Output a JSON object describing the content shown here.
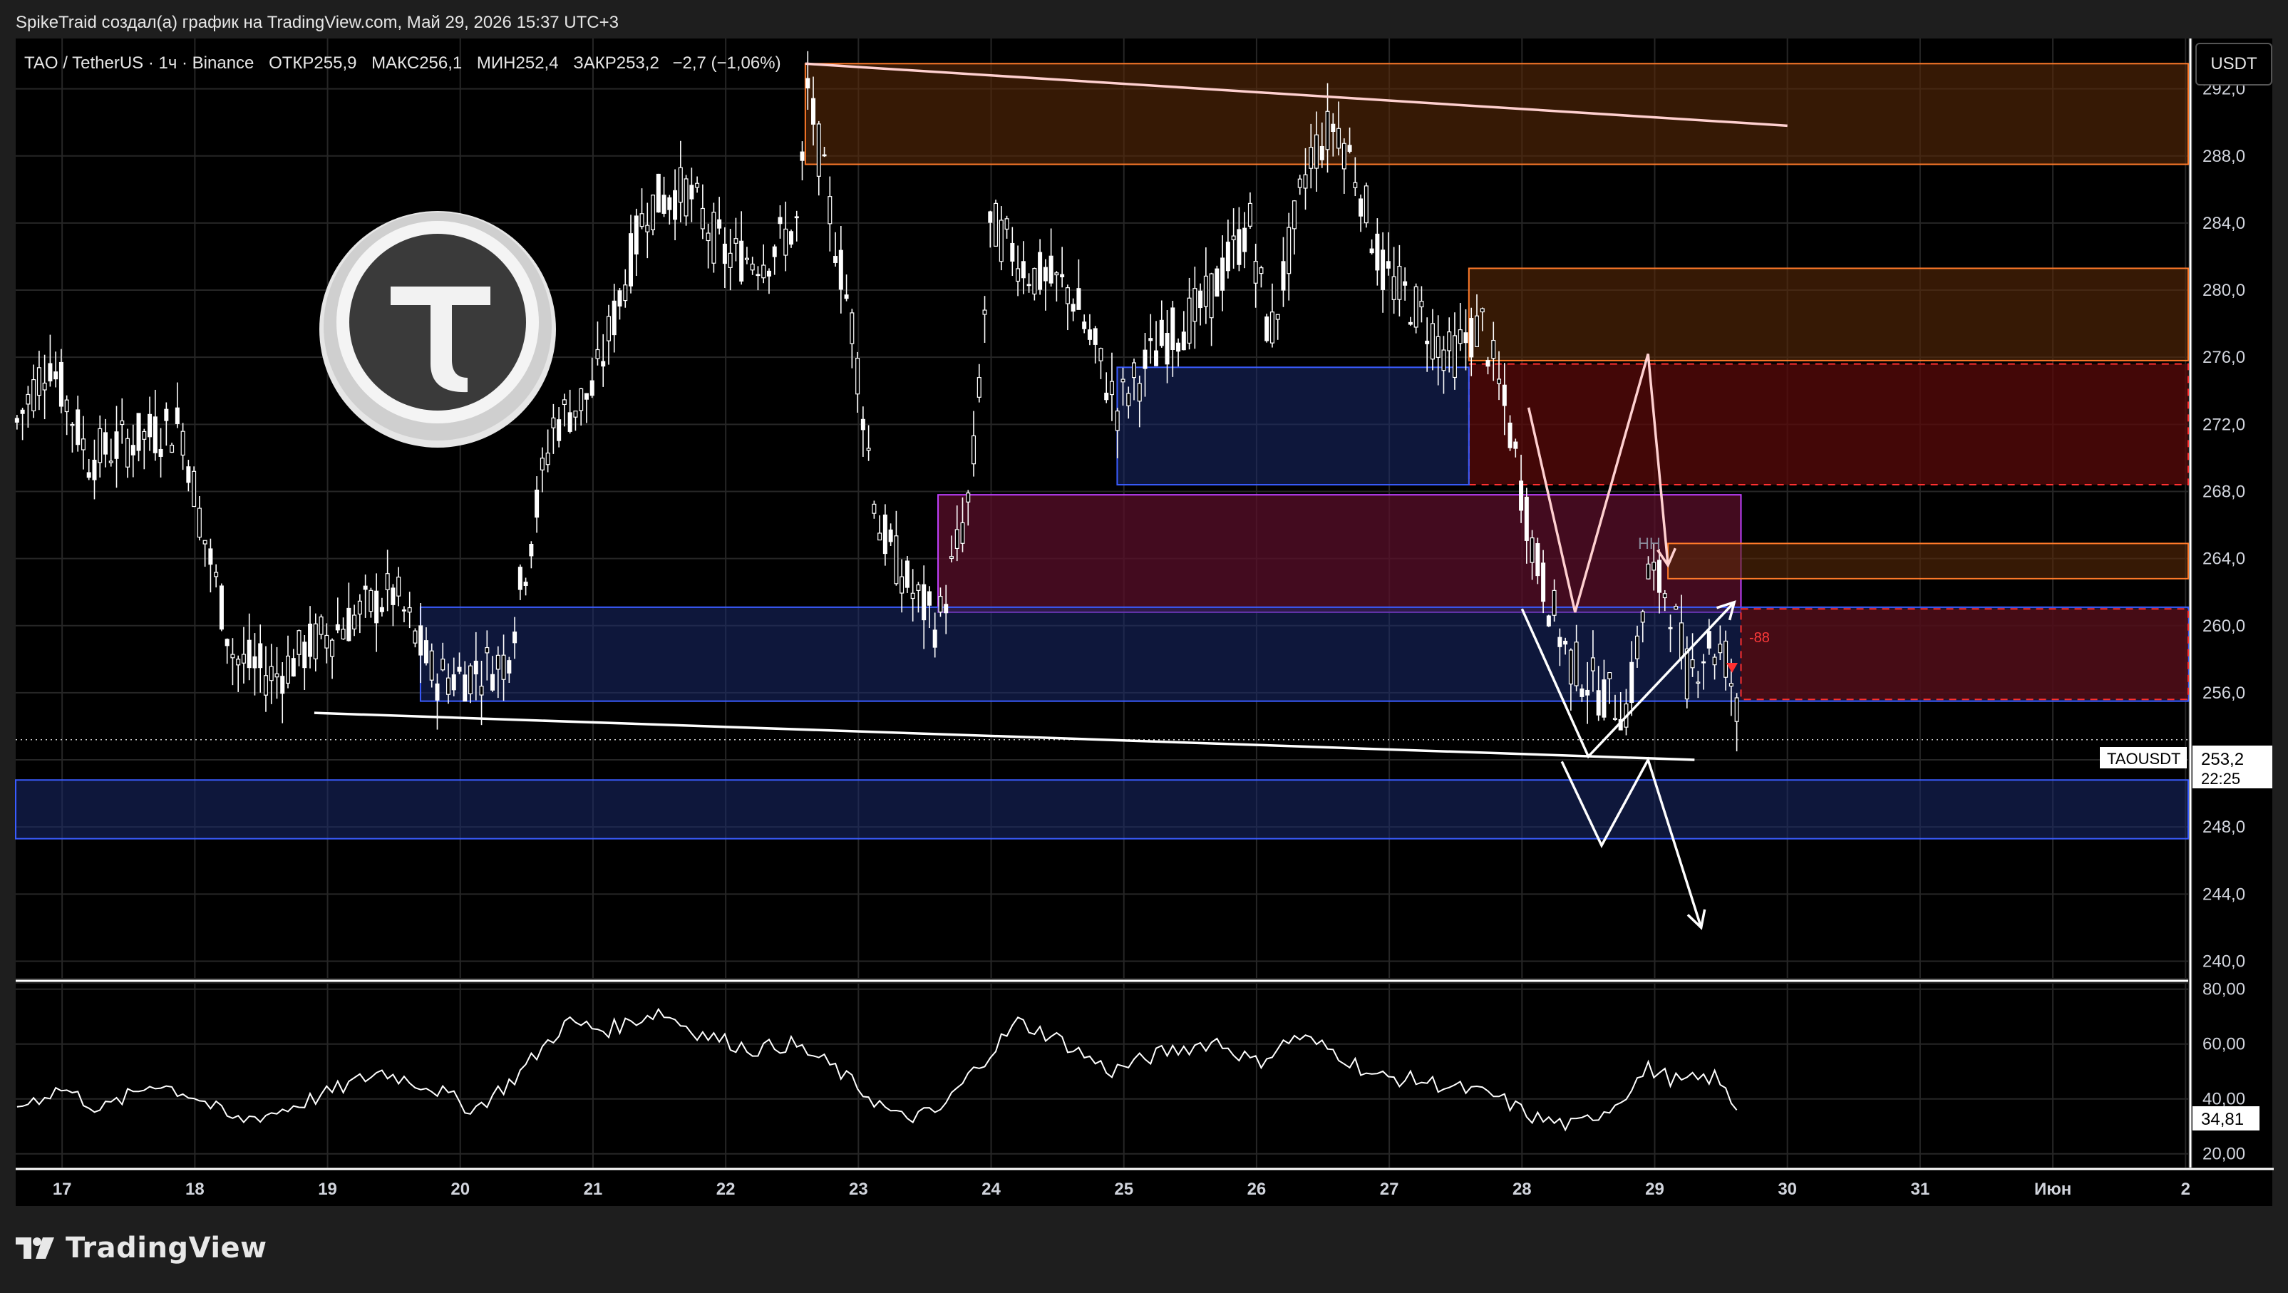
{
  "header": {
    "attribution": "SpikeTraid создал(а) график на TradingView.com, Май 29, 2026 15:37 UTC+3"
  },
  "legend": {
    "symbol": "TAO / TetherUS · 1ч · Binance",
    "open_label": "ОТКР",
    "open_value": "255,9",
    "high_label": "МАКС",
    "high_value": "256,1",
    "low_label": "МИН",
    "low_value": "252,4",
    "close_label": "ЗАКР",
    "close_value": "253,2",
    "change": "−2,7 (−1,06%)"
  },
  "currency_button": "USDT",
  "price_tag": {
    "ticker": "TAOUSDT",
    "price": "253,2",
    "countdown": "22:25"
  },
  "rsi_tag": "34,81",
  "annotations": {
    "hh_label": "HH",
    "red_tag": "-88"
  },
  "brand": {
    "name": "TradingView"
  },
  "colors": {
    "background": "#000000",
    "frame": "#1e1e1e",
    "candle": "#ffffff",
    "blue_zone": "#1a2a6c",
    "red_zone": "#5a0a0a",
    "orange_zone": "#5a2a08",
    "magenta_zone": "#5a0f2a",
    "magenta_border": "#c040ff",
    "orange_border": "#ff7a2a",
    "red_dash": "#ff3030"
  },
  "chart_data": {
    "type": "line",
    "series_type": "candlestick",
    "price_axis": {
      "ticks": [
        240,
        244,
        248,
        252,
        256,
        260,
        264,
        268,
        272,
        276,
        280,
        284,
        288,
        292
      ],
      "tick_labels": [
        "240,0",
        "244,0",
        "248,0",
        "252,0",
        "256,0",
        "260,0",
        "264,0",
        "268,0",
        "272,0",
        "276,0",
        "280,0",
        "284,0",
        "288,0",
        "292,0"
      ],
      "range": [
        239,
        295
      ]
    },
    "rsi_axis": {
      "ticks": [
        20,
        40,
        60,
        80
      ],
      "tick_labels": [
        "20,00",
        "40,00",
        "60,00",
        "80,00"
      ],
      "range": [
        15,
        82
      ]
    },
    "time_axis": {
      "labels": [
        "17",
        "18",
        "19",
        "20",
        "21",
        "22",
        "23",
        "24",
        "25",
        "26",
        "27",
        "28",
        "29",
        "30",
        "31",
        "Июн",
        "2"
      ],
      "range_days": [
        16.65,
        33.02
      ]
    },
    "last_price": 253.2,
    "last_rsi": 34.81,
    "zones": [
      {
        "kind": "orange",
        "x0": 22.6,
        "x1": 33.02,
        "y0": 287.5,
        "y1": 293.5
      },
      {
        "kind": "orange",
        "x0": 27.6,
        "x1": 33.02,
        "y0": 275.8,
        "y1": 281.3
      },
      {
        "kind": "red",
        "x0": 27.6,
        "x1": 33.02,
        "y0": 268.4,
        "y1": 275.6
      },
      {
        "kind": "blue",
        "x0": 24.95,
        "x1": 27.6,
        "y0": 268.4,
        "y1": 275.4
      },
      {
        "kind": "magenta",
        "x0": 23.6,
        "x1": 29.65,
        "y0": 260.8,
        "y1": 267.8
      },
      {
        "kind": "blue",
        "x0": 19.7,
        "x1": 33.02,
        "y0": 255.5,
        "y1": 261.1
      },
      {
        "kind": "orange",
        "x0": 29.1,
        "x1": 33.02,
        "y0": 262.8,
        "y1": 264.9
      },
      {
        "kind": "red",
        "x0": 29.65,
        "x1": 33.02,
        "y0": 255.6,
        "y1": 261.0
      },
      {
        "kind": "blue",
        "x0": 16.65,
        "x1": 33.02,
        "y0": 247.3,
        "y1": 250.8
      }
    ],
    "trendlines": [
      {
        "x0": 22.6,
        "y0": 293.5,
        "x1": 30.0,
        "y1": 289.8,
        "color": "#ffd0d0"
      },
      {
        "x0": 18.9,
        "y0": 254.8,
        "x1": 29.3,
        "y1": 252.0,
        "color": "#ffffff"
      }
    ],
    "projection_paths": [
      [
        [
          28.05,
          273.0
        ],
        [
          28.4,
          260.8
        ],
        [
          28.95,
          276.2
        ],
        [
          29.1,
          263.6
        ]
      ],
      [
        [
          28.0,
          261.0
        ],
        [
          28.5,
          252.2
        ],
        [
          29.6,
          261.4
        ]
      ],
      [
        [
          28.3,
          251.9
        ],
        [
          28.6,
          246.9
        ],
        [
          28.95,
          252.0
        ],
        [
          29.35,
          242.0
        ]
      ]
    ]
  }
}
